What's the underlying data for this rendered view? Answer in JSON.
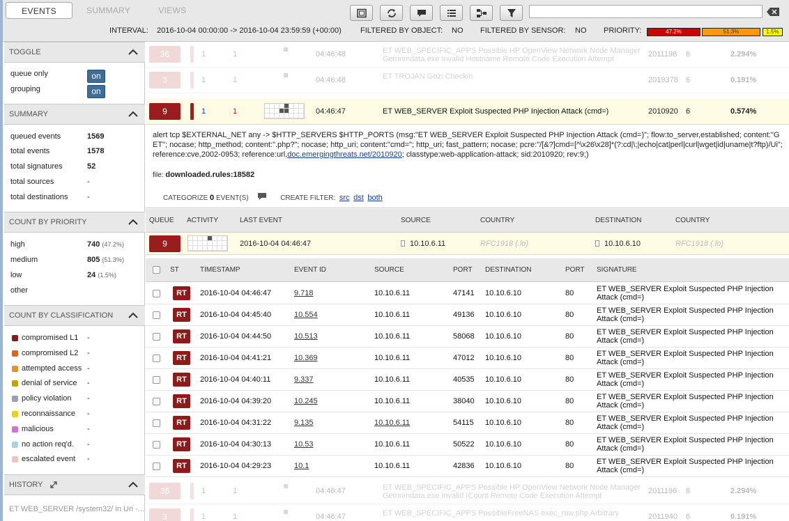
{
  "tabs": [
    "EVENTS",
    "SUMMARY",
    "VIEWS"
  ],
  "search": {
    "value": "",
    "placeholder": ""
  },
  "infobar": {
    "interval_label": "INTERVAL:",
    "interval_value": "2016-10-04 00:00:00 -> 2016-10-04 23:59:59 (+00:00)",
    "filtered_object_label": "FILTERED BY OBJECT:",
    "filtered_object_value": "NO",
    "filtered_sensor_label": "FILTERED BY SENSOR:",
    "filtered_sensor_value": "NO",
    "priority_label": "PRIORITY:",
    "priority_bars": [
      {
        "label": "47.2%",
        "value": 47.2,
        "color": "#cc0000"
      },
      {
        "label": "51.3%",
        "value": 51.3,
        "color": "#ff9900"
      },
      {
        "label": "1.5%",
        "value": 1.5,
        "color": "#ffff00"
      }
    ]
  },
  "sidebar": {
    "toggle": {
      "title": "TOGGLE",
      "items": [
        {
          "label": "queue only",
          "button": "on"
        },
        {
          "label": "grouping",
          "button": "on"
        }
      ]
    },
    "summary": {
      "title": "SUMMARY",
      "items": [
        {
          "label": "queued events",
          "value": "1569"
        },
        {
          "label": "total events",
          "value": "1578"
        },
        {
          "label": "total signatures",
          "value": "52"
        },
        {
          "label": "total sources",
          "value": "-"
        },
        {
          "label": "total destinations",
          "value": "-"
        }
      ]
    },
    "priority": {
      "title": "COUNT BY PRIORITY",
      "items": [
        {
          "label": "high",
          "value": "740",
          "pct": "(47.2%)"
        },
        {
          "label": "medium",
          "value": "805",
          "pct": "(51.3%)"
        },
        {
          "label": "low",
          "value": "24",
          "pct": "(1.5%)"
        },
        {
          "label": "other",
          "value": "",
          "pct": ""
        }
      ]
    },
    "classification": {
      "title": "COUNT BY CLASSIFICATION",
      "items": [
        {
          "label": "compromised L1",
          "value": "-",
          "color": "#8b1a1a"
        },
        {
          "label": "compromised L2",
          "value": "-",
          "color": "#e8630a"
        },
        {
          "label": "attempted access",
          "value": "-",
          "color": "#f28c28"
        },
        {
          "label": "denial of service",
          "value": "-",
          "color": "#c8a000"
        },
        {
          "label": "policy violation",
          "value": "-",
          "color": "#9aa0b8"
        },
        {
          "label": "reconnaissance",
          "value": "-",
          "color": "#f2d000"
        },
        {
          "label": "malicious",
          "value": "-",
          "color": "#d66fd6"
        },
        {
          "label": "no action req'd.",
          "value": "-",
          "color": "#a8d4e0"
        },
        {
          "label": "escalated event",
          "value": "-",
          "color": "#f4c0c0"
        }
      ]
    },
    "history": {
      "title": "HISTORY",
      "text": "ET WEB_SERVER /system32/ in Uri -..."
    }
  },
  "groups_top": [
    {
      "queue": "36",
      "c1": "1",
      "c2": "1",
      "time": "04:46:48",
      "sig": "ET WEB_SPECIFIC_APPS Possible HP OpenView Network Node Manager Getnnmdata.exe Invalid Hostname Remote Code Execution Attempt",
      "sid": "2011198",
      "rev": "6",
      "pct": "2.294%"
    },
    {
      "queue": "3",
      "c1": "1",
      "c2": "1",
      "time": "04:46:48",
      "sig": "ET TROJAN Gozi Checkin",
      "sid": "2019378",
      "rev": "6",
      "pct": "0.191%"
    }
  ],
  "selected_group": {
    "queue": "9",
    "c1": "1",
    "c2": "1",
    "time": "04:46:47",
    "sig": "ET WEB_SERVER Exploit Suspected PHP Injection Attack (cmd=)",
    "sid": "2010920",
    "rev": "6",
    "pct": "0.574%"
  },
  "rule": {
    "text": "alert tcp $EXTERNAL_NET any -> $HTTP_SERVERS $HTTP_PORTS (msg:\"ET WEB_SERVER Exploit Suspected PHP Injection Attack (cmd=)\"; flow:to_server,established; content:\"GET\"; nocase; http_method; content:\".php?\"; nocase; http_uri; content:\"cmd=\"; http_uri; fast_pattern; nocase; pcre:\"/[&?]cmd=[^\\x26\\x28]*(?:cd|\\;|echo|cat|perl|curl|wget|id|uname|t?ftp)/Ui\"; reference:cve,2002-0953; reference:url,",
    "link": "doc.emergingthreats.net/2010920",
    "tail": "; classtype:web-application-attack; sid:2010920; rev:9;)",
    "file_label": "file:",
    "file_value": "downloaded.rules:18582",
    "categorize_label": "CATEGORIZE",
    "categorize_count": "0",
    "categorize_suffix": "EVENT(S)",
    "create_filter_label": "CREATE FILTER:",
    "filter_links": [
      "src",
      "dst",
      "both"
    ]
  },
  "source_header": [
    "QUEUE",
    "ACTIVITY",
    "LAST EVENT",
    "SOURCE",
    "COUNTRY",
    "DESTINATION",
    "COUNTRY"
  ],
  "source_row": {
    "queue": "9",
    "last_event": "2016-10-04 04:46:47",
    "source": "10.10.6.11",
    "src_country": "RFC1918 (.lo)",
    "destination": "10.10.6.10",
    "dst_country": "RFC1918 (.lo)"
  },
  "event_header": [
    "ST",
    "TIMESTAMP",
    "EVENT ID",
    "SOURCE",
    "PORT",
    "DESTINATION",
    "PORT",
    "SIGNATURE"
  ],
  "events": [
    {
      "st": "RT",
      "ts": "2016-10-04 04:46:47",
      "id": "9.718",
      "src": "10.10.6.11",
      "sport": "47141",
      "dst": "10.10.6.10",
      "dport": "80",
      "sig": "ET WEB_SERVER Exploit Suspected PHP Injection Attack (cmd=)"
    },
    {
      "st": "RT",
      "ts": "2016-10-04 04:45:40",
      "id": "10.554",
      "src": "10.10.6.11",
      "sport": "49136",
      "dst": "10.10.6.10",
      "dport": "80",
      "sig": "ET WEB_SERVER Exploit Suspected PHP Injection Attack (cmd=)"
    },
    {
      "st": "RT",
      "ts": "2016-10-04 04:44:50",
      "id": "10.513",
      "src": "10.10.6.11",
      "sport": "58068",
      "dst": "10.10.6.10",
      "dport": "80",
      "sig": "ET WEB_SERVER Exploit Suspected PHP Injection Attack (cmd=)"
    },
    {
      "st": "RT",
      "ts": "2016-10-04 04:41:21",
      "id": "10.369",
      "src": "10.10.6.11",
      "sport": "47012",
      "dst": "10.10.6.10",
      "dport": "80",
      "sig": "ET WEB_SERVER Exploit Suspected PHP Injection Attack (cmd=)"
    },
    {
      "st": "RT",
      "ts": "2016-10-04 04:40:11",
      "id": "9.337",
      "src": "10.10.6.11",
      "sport": "40535",
      "dst": "10.10.6.10",
      "dport": "80",
      "sig": "ET WEB_SERVER Exploit Suspected PHP Injection Attack (cmd=)"
    },
    {
      "st": "RT",
      "ts": "2016-10-04 04:39:20",
      "id": "10.245",
      "src": "10.10.6.11",
      "sport": "38040",
      "dst": "10.10.6.10",
      "dport": "80",
      "sig": "ET WEB_SERVER Exploit Suspected PHP Injection Attack (cmd=)"
    },
    {
      "st": "RT",
      "ts": "2016-10-04 04:31:22",
      "id": "9.135",
      "src": "10.10.6.11",
      "sport": "54115",
      "dst": "10.10.6.10",
      "dport": "80",
      "sig": "ET WEB_SERVER Exploit Suspected PHP Injection Attack (cmd=)"
    },
    {
      "st": "RT",
      "ts": "2016-10-04 04:30:13",
      "id": "10.53",
      "src": "10.10.6.11",
      "sport": "50522",
      "dst": "10.10.6.10",
      "dport": "80",
      "sig": "ET WEB_SERVER Exploit Suspected PHP Injection Attack (cmd=)"
    },
    {
      "st": "RT",
      "ts": "2016-10-04 04:29:23",
      "id": "10.1",
      "src": "10.10.6.11",
      "sport": "42836",
      "dst": "10.10.6.10",
      "dport": "80",
      "sig": "ET WEB_SERVER Exploit Suspected PHP Injection Attack (cmd=)"
    }
  ],
  "groups_bottom": [
    {
      "queue": "36",
      "c1": "1",
      "c2": "1",
      "time": "04:46:47",
      "sig": "ET WEB_SPECIFIC_APPS Possible HP OpenView Network Node Manager Getnnmdata.exe Invalid ICount Remote Code Execution Attempt",
      "sid": "2011196",
      "rev": "6",
      "pct": "2.294%"
    },
    {
      "queue": "3",
      "c1": "1",
      "c2": "1",
      "time": "04:46:47",
      "sig": "ET WEB_SPECIFIC_APPS PossibleFreeNAS exec_raw.php Arbitrary",
      "sid": "2011940",
      "rev": "6",
      "pct": "0.191%"
    }
  ]
}
